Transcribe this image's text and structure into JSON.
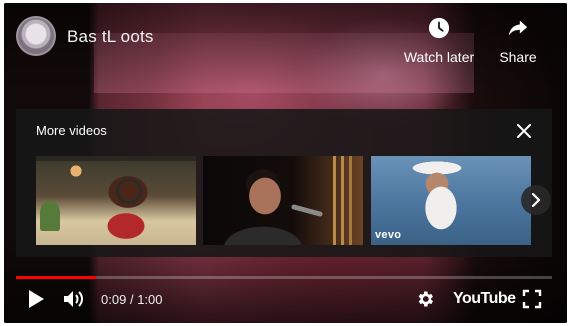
{
  "video": {
    "title": "Bas tL oots",
    "channel_avatar_icon": "channel-avatar"
  },
  "top_actions": {
    "watch_later": {
      "label": "Watch later",
      "icon": "clock-icon"
    },
    "share": {
      "label": "Share",
      "icon": "share-arrow-icon"
    }
  },
  "more_videos": {
    "title": "More videos",
    "close_icon": "close-icon",
    "thumbnails": [
      {
        "badge": ""
      },
      {
        "badge": ""
      },
      {
        "badge": "vevo"
      }
    ],
    "next_icon": "chevron-right-icon"
  },
  "playback": {
    "current_time": "0:09",
    "separator": "/",
    "duration": "1:00",
    "played_fraction": 0.15,
    "buffered_fraction": 0.15,
    "accent_color": "#ff0000"
  },
  "controls": {
    "play_icon": "play-icon",
    "volume_icon": "volume-icon",
    "settings_icon": "gear-icon",
    "logo_text": "YouTube",
    "fullscreen_icon": "fullscreen-icon"
  }
}
